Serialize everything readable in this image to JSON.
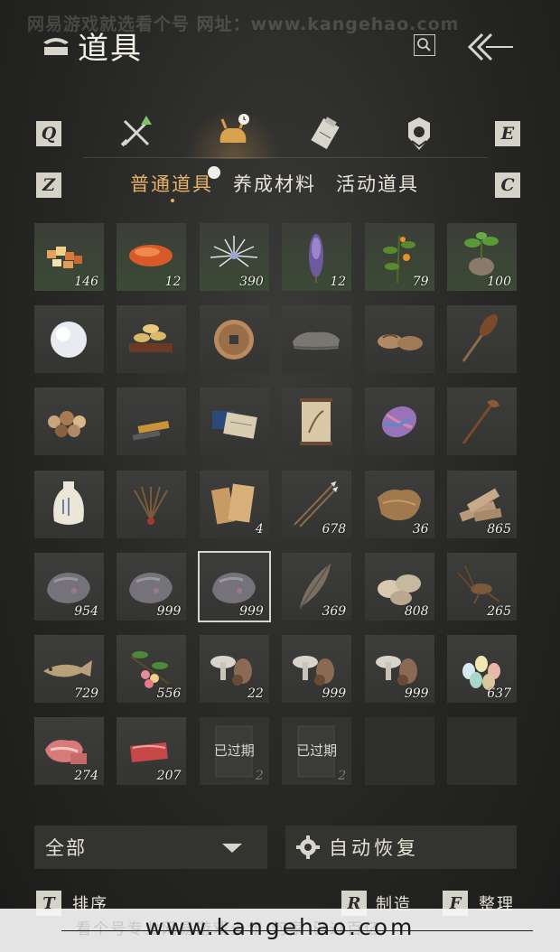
{
  "watermark": {
    "top_text": "网易游戏就选看个号   网址：www.kangehao.com",
    "footer_url": "www.kangehao.com",
    "footer_faint": "看个号专业网易游戏少年 何家 已过百亿"
  },
  "header": {
    "title": "道具",
    "search_icon": "search-icon",
    "back_icon": "back-arrows-icon"
  },
  "category_tabs": {
    "left_key": "Q",
    "right_key": "E",
    "tabs": [
      "weapons-icon",
      "bag-icon",
      "scroll-icon",
      "gem-icon"
    ],
    "active_index": 1
  },
  "sub_tabs": {
    "left_key": "Z",
    "right_key": "C",
    "items": [
      "普通道具",
      "养成材料",
      "活动道具"
    ],
    "active_index": 0
  },
  "items": [
    {
      "icon": "candied-fruits-icon",
      "count": "146"
    },
    {
      "icon": "orange-stone-icon",
      "count": "12"
    },
    {
      "icon": "white-flower-icon",
      "count": "390"
    },
    {
      "icon": "purple-herb-icon",
      "count": "12"
    },
    {
      "icon": "orange-berry-plant-icon",
      "count": "79"
    },
    {
      "icon": "green-herb-root-icon",
      "count": "100"
    },
    {
      "icon": "snowball-icon",
      "count": ""
    },
    {
      "icon": "pastry-tray-icon",
      "count": ""
    },
    {
      "icon": "bronze-coin-icon",
      "count": ""
    },
    {
      "icon": "pillow-icon",
      "count": ""
    },
    {
      "icon": "straw-sandals-icon",
      "count": ""
    },
    {
      "icon": "cattail-icon",
      "count": ""
    },
    {
      "icon": "mushrooms-icon",
      "count": ""
    },
    {
      "icon": "ink-sticks-icon",
      "count": ""
    },
    {
      "icon": "books-icon",
      "count": ""
    },
    {
      "icon": "painting-scroll-icon",
      "count": ""
    },
    {
      "icon": "yarn-icon",
      "count": ""
    },
    {
      "icon": "hairpin-icon",
      "count": ""
    },
    {
      "icon": "porcelain-vase-icon",
      "count": ""
    },
    {
      "icon": "dried-plant-icon",
      "count": ""
    },
    {
      "icon": "paper-sheets-icon",
      "count": "4"
    },
    {
      "icon": "arrows-icon",
      "count": "678"
    },
    {
      "icon": "fur-pelt-icon",
      "count": "36"
    },
    {
      "icon": "wood-pile-icon",
      "count": "865"
    },
    {
      "icon": "ore-icon",
      "count": "954"
    },
    {
      "icon": "ore-icon",
      "count": "999"
    },
    {
      "icon": "ore-icon",
      "count": "999",
      "selected": true
    },
    {
      "icon": "feather-icon",
      "count": "369"
    },
    {
      "icon": "shells-icon",
      "count": "808"
    },
    {
      "icon": "cricket-icon",
      "count": "265"
    },
    {
      "icon": "fish-icon",
      "count": "729"
    },
    {
      "icon": "lychee-branch-icon",
      "count": "556"
    },
    {
      "icon": "mushroom-cluster-icon",
      "count": "22"
    },
    {
      "icon": "mushroom-cluster-icon",
      "count": "999"
    },
    {
      "icon": "mushroom-cluster-icon",
      "count": "999"
    },
    {
      "icon": "colored-eggs-icon",
      "count": "637"
    },
    {
      "icon": "raw-meat-icon",
      "count": "274"
    },
    {
      "icon": "raw-steak-icon",
      "count": "207"
    },
    {
      "icon": "expired-item-icon",
      "count": "2",
      "expired_label": "已过期"
    },
    {
      "icon": "expired-item-icon",
      "count": "2",
      "expired_label": "已过期"
    },
    {
      "icon": "",
      "count": "",
      "empty": true
    },
    {
      "icon": "",
      "count": "",
      "empty": true
    }
  ],
  "filter": {
    "label": "全部",
    "icon": "chevron-down-icon"
  },
  "auto_restore": {
    "label": "自动恢复",
    "icon": "gear-icon"
  },
  "bottom_actions": [
    {
      "key": "T",
      "label": "排序"
    },
    {
      "key": "R",
      "label": "制造"
    },
    {
      "key": "F",
      "label": "整理"
    }
  ],
  "colors": {
    "accent": "#e6b26a",
    "background": "#262624",
    "cell": "#3a3a38"
  }
}
